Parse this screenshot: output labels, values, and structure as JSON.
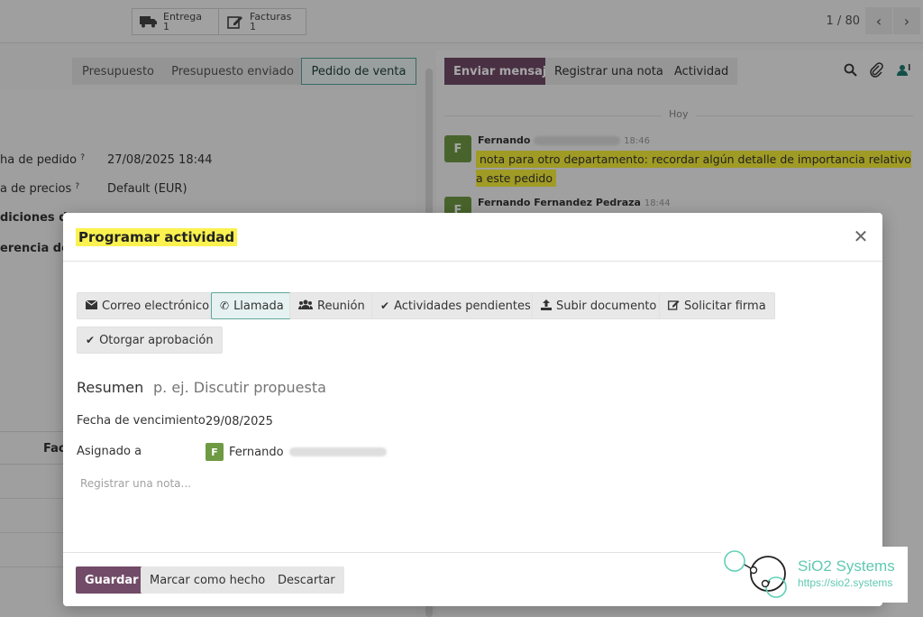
{
  "topbar": {
    "smart_buttons": [
      {
        "label": "Entrega",
        "count": "1",
        "icon": "truck-icon"
      },
      {
        "label": "Facturas",
        "count": "1",
        "icon": "edit-invoice-icon"
      }
    ],
    "pager": "1 / 80"
  },
  "statusbar": {
    "stages": [
      "Presupuesto",
      "Presupuesto enviado",
      "Pedido de venta"
    ]
  },
  "form": {
    "fields": [
      {
        "label": "ha de pedido",
        "value": "27/08/2025 18:44"
      },
      {
        "label": "a de precios",
        "value": "Default (EUR)"
      },
      {
        "label": "diciones de",
        "value": ""
      },
      {
        "label": "erencia del c",
        "value": ""
      }
    ],
    "tab_label": "Fact"
  },
  "chatter": {
    "send_message": "Enviar mensaje",
    "log_note": "Registrar una nota",
    "activity": "Actividad",
    "day_separator": "Hoy",
    "messages": [
      {
        "author": "Fernando",
        "time": "18:46",
        "avatar": "F",
        "body": "nota para otro departamento: recordar algún detalle de importancia relativo a este pedido"
      },
      {
        "author": "Fernando Fernandez Pedraza",
        "time": "18:44",
        "avatar": "F",
        "body": ""
      }
    ]
  },
  "modal": {
    "title": "Programar actividad",
    "activity_types": [
      {
        "label": "Correo electrónico",
        "icon": "envelope-icon",
        "selected": false
      },
      {
        "label": "Llamada",
        "icon": "phone-icon",
        "selected": true
      },
      {
        "label": "Reunión",
        "icon": "users-icon",
        "selected": false
      },
      {
        "label": "Actividades pendientes",
        "icon": "check-icon",
        "selected": false
      },
      {
        "label": "Subir documento",
        "icon": "upload-icon",
        "selected": false
      },
      {
        "label": "Solicitar firma",
        "icon": "signature-icon",
        "selected": false
      },
      {
        "label": "Otorgar aprobación",
        "icon": "check-icon",
        "selected": false
      }
    ],
    "summary_label": "Resumen",
    "summary_placeholder": "p. ej. Discutir propuesta",
    "due_date_label": "Fecha de vencimiento",
    "due_date_value": "29/08/2025",
    "assigned_label": "Asignado a",
    "assigned_avatar": "F",
    "assigned_name": "Fernando",
    "note_placeholder": "Registrar una nota...",
    "save": "Guardar",
    "mark_done": "Marcar como hecho",
    "discard": "Descartar"
  },
  "watermark": {
    "brand": "SiO2 Systems",
    "url": "https://sio2.systems"
  },
  "colors": {
    "primary": "#714b67",
    "selected_border": "#60a59c",
    "highlight": "#f6ee3a",
    "avatar": "#6f9a44"
  }
}
